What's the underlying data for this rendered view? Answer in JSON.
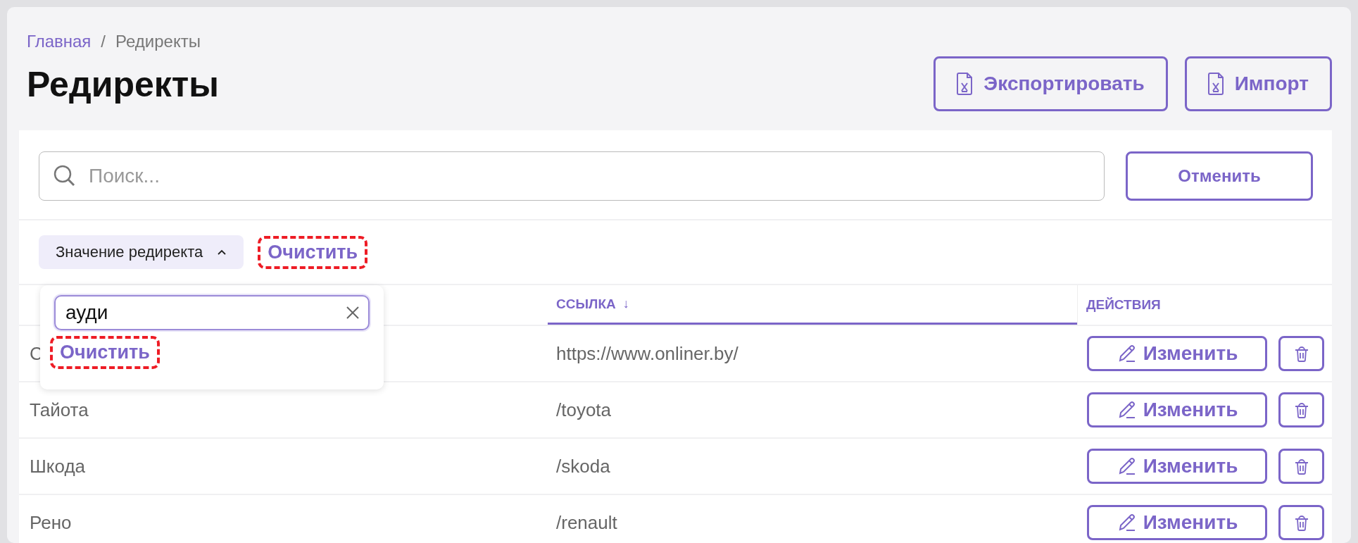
{
  "breadcrumbs": [
    {
      "label": "Главная",
      "link": true
    },
    {
      "label": "Редиректы",
      "link": false
    }
  ],
  "breadcrumb_separator": "/",
  "title": "Редиректы",
  "header_buttons": [
    {
      "label": "Экспортировать"
    },
    {
      "label": "Импорт"
    }
  ],
  "search": {
    "placeholder": "Поиск..."
  },
  "cancel_button": "Отменить",
  "filter": {
    "label": "Значение редиректа",
    "expanded": true,
    "clear_label": "Очистить",
    "clear_highlighted": true
  },
  "filter_popup": {
    "value": "ауди",
    "clear_label": "Очистить",
    "clear_highlighted": true
  },
  "table": {
    "columns": [
      {
        "sorted": false
      },
      {
        "label": "ССЫЛКА",
        "sorted": true,
        "sort_icon": "↓"
      },
      {
        "label": "ДЕЙСТВИЯ",
        "sorted": false
      }
    ],
    "rows": [
      {
        "name": "С",
        "url": "https://www.onliner.by/",
        "edit_label": "Изменить"
      },
      {
        "name": "Тайота",
        "url": "/toyota",
        "edit_label": "Изменить"
      },
      {
        "name": "Шкода",
        "url": "/skoda",
        "edit_label": "Изменить"
      },
      {
        "name": "Рено",
        "url": "/renault",
        "edit_label": "Изменить"
      }
    ]
  }
}
